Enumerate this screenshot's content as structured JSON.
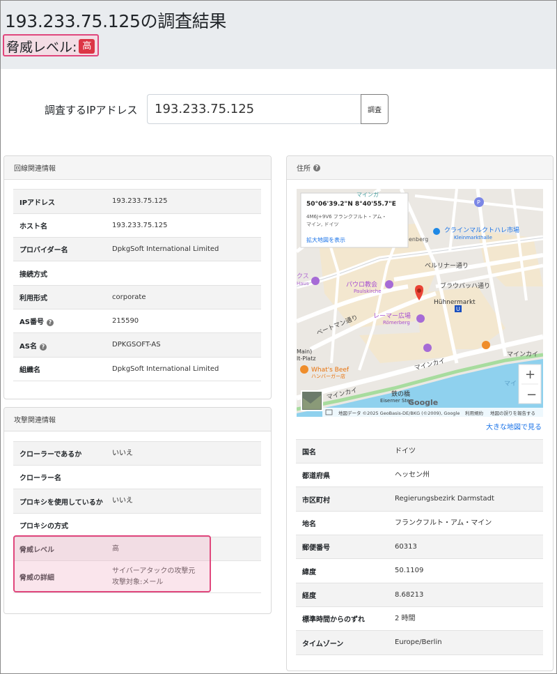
{
  "page": {
    "title": "193.233.75.125の調査結果",
    "threat_label": "脅威レベル:",
    "threat_level": "高"
  },
  "search": {
    "label": "調査するIPアドレス",
    "value": "193.233.75.125",
    "button": "調査"
  },
  "line_info": {
    "header": "回線関連情報",
    "rows": [
      {
        "k": "IPアドレス",
        "v": "193.233.75.125"
      },
      {
        "k": "ホスト名",
        "v": "193.233.75.125"
      },
      {
        "k": "プロバイダー名",
        "v": "DpkgSoft International Limited"
      },
      {
        "k": "接続方式",
        "v": ""
      },
      {
        "k": "利用形式",
        "v": "corporate"
      },
      {
        "k": "AS番号",
        "v": "215590"
      },
      {
        "k": "AS名",
        "v": "DPKGSOFT-AS"
      },
      {
        "k": "組織名",
        "v": "DpkgSoft International Limited"
      }
    ]
  },
  "attack_info": {
    "header": "攻撃関連情報",
    "rows": [
      {
        "k": "クローラーであるか",
        "v": "いいえ"
      },
      {
        "k": "クローラー名",
        "v": ""
      },
      {
        "k": "プロキシを使用しているか",
        "v": "いいえ"
      },
      {
        "k": "プロキシの方式",
        "v": ""
      },
      {
        "k": "脅威レベル",
        "v": "高"
      },
      {
        "k": "脅威の詳細",
        "v": "サイバーアタックの攻撃元",
        "v2": "攻撃対象:メール"
      }
    ]
  },
  "address": {
    "header": "住所",
    "map": {
      "coords": "50°06'39.2\"N 8°40'55.7\"E",
      "plus_code": "4M6J+9V6 フランクフルト・アム・",
      "plus_code2": "マイン, ドイツ",
      "enlarge": "拡大地図を表示",
      "big_map_link": "大きな地図で見る",
      "labels": {
        "market": "クラインマルクトハレ市場",
        "market_sub": "Kleinmarkthalle",
        "berliner": "ベルリナー通り",
        "paulus": "パウロ教会",
        "paulus_sub": "Paulskirche",
        "braubach": "ブラウバッハ通り",
        "huhner": "Hühnermarkt",
        "romer": "レーマー広場",
        "romer_sub": "Römerberg",
        "bethmann": "ベートマン通り",
        "whats": "What's Beef",
        "whats_sub": "ハンバーガー店",
        "mainkai": "マインカイ",
        "mainkai2": "マインカイ",
        "mainkai3": "マインカイ",
        "eiserner": "鉄の橋",
        "eiserner_sub": "Eiserner Steg",
        "main_platz": "Main)",
        "platz": "lt-Platz",
        "berg": "enberg",
        "kus": "クス",
        "haus": "Haus",
        "top": "マインガ",
        "ma": "マイ",
        "google": "Google",
        "attribution": "地図データ ©2025 GeoBasis-DE/BKG (©2009), Google",
        "terms": "利用規約",
        "report": "地図の誤りを報告する"
      }
    },
    "rows": [
      {
        "k": "国名",
        "v": "ドイツ"
      },
      {
        "k": "都道府県",
        "v": "ヘッセン州"
      },
      {
        "k": "市区町村",
        "v": "Regierungsbezirk Darmstadt"
      },
      {
        "k": "地名",
        "v": "フランクフルト・アム・マイン"
      },
      {
        "k": "郵便番号",
        "v": "60313"
      },
      {
        "k": "緯度",
        "v": "50.1109"
      },
      {
        "k": "経度",
        "v": "8.68213"
      },
      {
        "k": "標準時間からのずれ",
        "v": "2 時間"
      },
      {
        "k": "タイムゾーン",
        "v": "Europe/Berlin"
      }
    ]
  }
}
